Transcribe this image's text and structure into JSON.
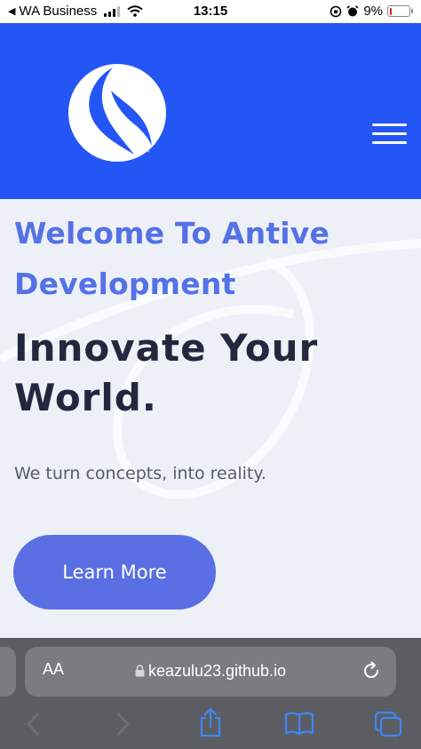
{
  "status_bar": {
    "carrier": "WA Business",
    "time": "13:15",
    "battery": "9%",
    "battery_level": 0.09,
    "icons": [
      "back-triangle-icon",
      "signal-icon",
      "wifi-icon",
      "orientation-lock-icon",
      "alarm-icon",
      "battery-icon"
    ]
  },
  "header": {
    "logo": "antive-logo",
    "menu_icon": "hamburger-icon",
    "background": "#2456f5"
  },
  "hero": {
    "welcome": "Welcome To Antive Development",
    "tagline": "Innovate Your World.",
    "subtitle": "We turn concepts, into reality.",
    "cta_label": "Learn More",
    "welcome_color": "#5472e6",
    "cta_color": "#5a6fe4"
  },
  "browser": {
    "aa_label": "AA",
    "url": "keazulu23.github.io",
    "icons": [
      "lock-icon",
      "reload-icon",
      "back-arrow-icon",
      "forward-arrow-icon",
      "share-icon",
      "bookmarks-icon",
      "tabs-icon"
    ]
  }
}
